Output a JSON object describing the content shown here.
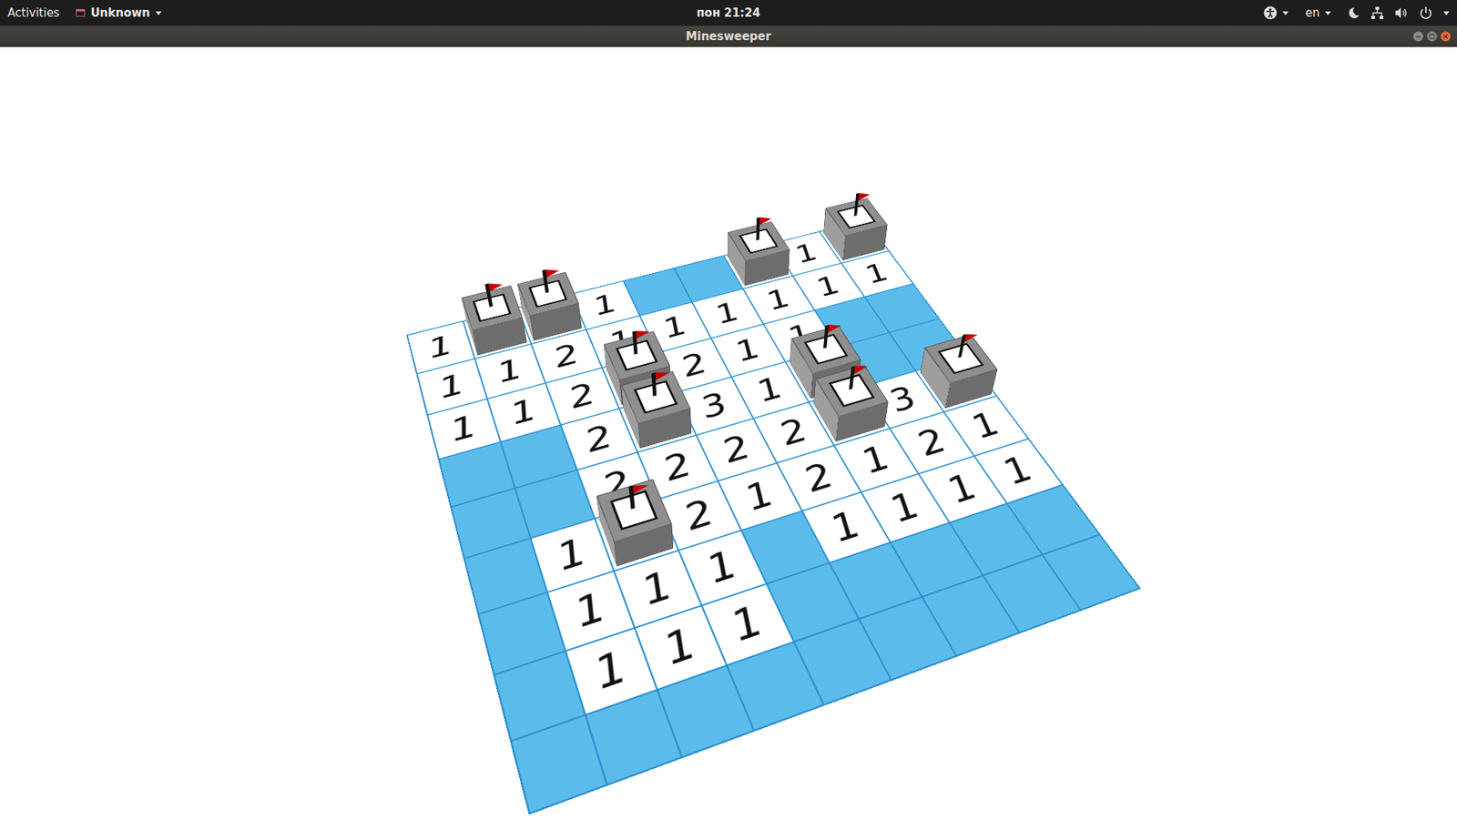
{
  "top_bar": {
    "activities": "Activities",
    "app_menu": "Unknown",
    "clock": "пон 21:24",
    "language": "en"
  },
  "window": {
    "title": "Minesweeper"
  },
  "board": {
    "rows": [
      [
        {
          "kind": "number",
          "text": "1"
        },
        {
          "kind": "flag"
        },
        {
          "kind": "flag"
        },
        {
          "kind": "number",
          "text": "1"
        },
        {
          "kind": "empty"
        },
        {
          "kind": "empty"
        },
        {
          "kind": "flag"
        },
        {
          "kind": "number",
          "text": "1"
        },
        {
          "kind": "flag"
        }
      ],
      [
        {
          "kind": "number",
          "text": "1"
        },
        {
          "kind": "number",
          "text": "1"
        },
        {
          "kind": "number",
          "text": "2"
        },
        {
          "kind": "number",
          "text": "1"
        },
        {
          "kind": "number",
          "text": "1"
        },
        {
          "kind": "number",
          "text": "1"
        },
        {
          "kind": "number",
          "text": "1"
        },
        {
          "kind": "number",
          "text": "1"
        },
        {
          "kind": "number",
          "text": "1"
        }
      ],
      [
        {
          "kind": "number",
          "text": "1"
        },
        {
          "kind": "number",
          "text": "1"
        },
        {
          "kind": "number",
          "text": "2"
        },
        {
          "kind": "flag"
        },
        {
          "kind": "number",
          "text": "2"
        },
        {
          "kind": "number",
          "text": "1"
        },
        {
          "kind": "number",
          "text": "1"
        },
        {
          "kind": "empty"
        },
        {
          "kind": "empty"
        }
      ],
      [
        {
          "kind": "empty"
        },
        {
          "kind": "empty"
        },
        {
          "kind": "number",
          "text": "2"
        },
        {
          "kind": "flag"
        },
        {
          "kind": "number",
          "text": "3"
        },
        {
          "kind": "number",
          "text": "1"
        },
        {
          "kind": "flag"
        },
        {
          "kind": "empty"
        },
        {
          "kind": "empty"
        }
      ],
      [
        {
          "kind": "empty"
        },
        {
          "kind": "empty"
        },
        {
          "kind": "number",
          "text": "2"
        },
        {
          "kind": "number",
          "text": "2"
        },
        {
          "kind": "number",
          "text": "2"
        },
        {
          "kind": "number",
          "text": "2"
        },
        {
          "kind": "flag"
        },
        {
          "kind": "number",
          "text": "3"
        },
        {
          "kind": "flag"
        }
      ],
      [
        {
          "kind": "empty"
        },
        {
          "kind": "number",
          "text": "1"
        },
        {
          "kind": "flag"
        },
        {
          "kind": "number",
          "text": "2"
        },
        {
          "kind": "number",
          "text": "1"
        },
        {
          "kind": "number",
          "text": "2"
        },
        {
          "kind": "number",
          "text": "1"
        },
        {
          "kind": "number",
          "text": "2"
        },
        {
          "kind": "number",
          "text": "1"
        }
      ],
      [
        {
          "kind": "empty"
        },
        {
          "kind": "number",
          "text": "1"
        },
        {
          "kind": "number",
          "text": "1"
        },
        {
          "kind": "number",
          "text": "1"
        },
        {
          "kind": "empty"
        },
        {
          "kind": "number",
          "text": "1"
        },
        {
          "kind": "number",
          "text": "1"
        },
        {
          "kind": "number",
          "text": "1"
        },
        {
          "kind": "number",
          "text": "1"
        }
      ],
      [
        {
          "kind": "empty"
        },
        {
          "kind": "number",
          "text": "1"
        },
        {
          "kind": "number",
          "text": "1"
        },
        {
          "kind": "number",
          "text": "1"
        },
        {
          "kind": "empty"
        },
        {
          "kind": "empty"
        },
        {
          "kind": "empty"
        },
        {
          "kind": "empty"
        },
        {
          "kind": "empty"
        }
      ],
      [
        {
          "kind": "empty"
        },
        {
          "kind": "empty"
        },
        {
          "kind": "empty"
        },
        {
          "kind": "empty"
        },
        {
          "kind": "empty"
        },
        {
          "kind": "empty"
        },
        {
          "kind": "empty"
        },
        {
          "kind": "empty"
        },
        {
          "kind": "empty"
        }
      ]
    ]
  }
}
